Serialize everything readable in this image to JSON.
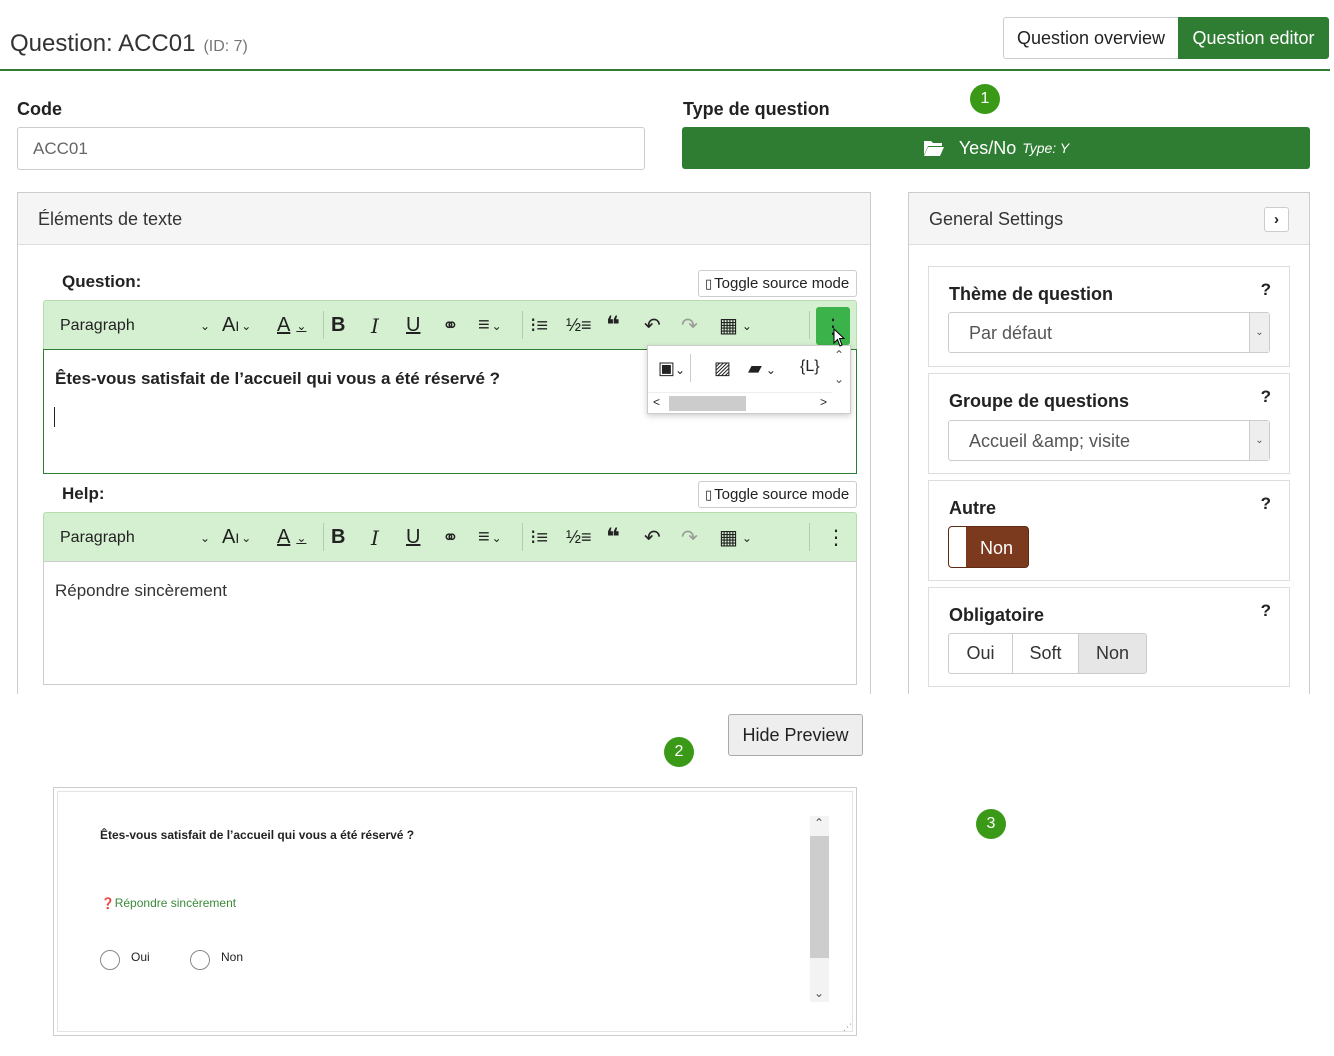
{
  "header": {
    "title": "Question: ACC01",
    "id_text": "(ID: 7)",
    "btn_overview": "Question overview",
    "btn_editor": "Question editor"
  },
  "badges": {
    "b1": "1",
    "b2": "2",
    "b3": "3"
  },
  "code": {
    "label": "Code",
    "value": "ACC01"
  },
  "qtype": {
    "label": "Type de question",
    "value": "Yes/No",
    "type_label": "Type: Y"
  },
  "text_elements": {
    "title": "Éléments de texte",
    "question_label": "Question:",
    "help_label": "Help:",
    "toggle_source": "Toggle source mode",
    "paragraph": "Paragraph",
    "question_text": "Êtes-vous satisfait de l’accueil qui vous a été réservé ?",
    "help_text": "Répondre sincèrement"
  },
  "general": {
    "title": "General Settings",
    "theme_label": "Thème de question",
    "theme_value": "Par défaut",
    "group_label": "Groupe de questions",
    "group_value": "Accueil &amp; visite",
    "other_label": "Autre",
    "other_value": "Non",
    "mandatory_label": "Obligatoire",
    "mandatory_options": [
      "Oui",
      "Soft",
      "Non"
    ],
    "help_mark": "?"
  },
  "preview": {
    "hide_btn": "Hide Preview",
    "question": "Êtes-vous satisfait de l’accueil qui vous a été réservé ?",
    "help": "Répondre sincèrement",
    "options": [
      "Oui",
      "Non"
    ]
  },
  "colors": {
    "primary": "#2e7d32",
    "toolbar": "#d5f0d0",
    "badge": "#3a9a18",
    "toggle": "#7b3a1e"
  }
}
